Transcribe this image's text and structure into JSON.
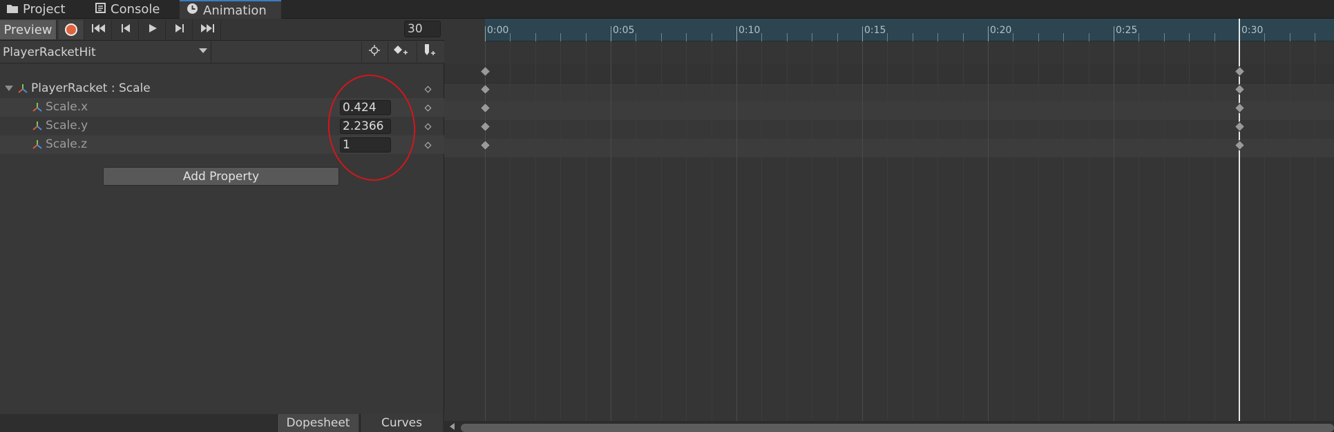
{
  "tabs": [
    {
      "label": "Project",
      "icon": "folder-icon"
    },
    {
      "label": "Console",
      "icon": "console-icon"
    },
    {
      "label": "Animation",
      "icon": "clock-icon",
      "active": true
    }
  ],
  "toolbar": {
    "preview_label": "Preview",
    "frame": "30"
  },
  "clip": {
    "name": "PlayerRacketHit"
  },
  "properties": {
    "group_label": "PlayerRacket : Scale",
    "rows": [
      {
        "label": "Scale.x",
        "value": "0.424"
      },
      {
        "label": "Scale.y",
        "value": "2.2366"
      },
      {
        "label": "Scale.z",
        "value": "1"
      }
    ]
  },
  "add_property_label": "Add Property",
  "bottom_tabs": {
    "dopesheet": "Dopesheet",
    "curves": "Curves"
  },
  "timeline": {
    "ruler_labels": [
      "0:00",
      "0:05",
      "0:10",
      "0:15",
      "0:20",
      "0:25",
      "0:30"
    ]
  },
  "colors": {
    "accent": "#3b7dc4",
    "record": "#e0633e",
    "annotation": "#d4161b",
    "ruler": "#2c4550"
  }
}
